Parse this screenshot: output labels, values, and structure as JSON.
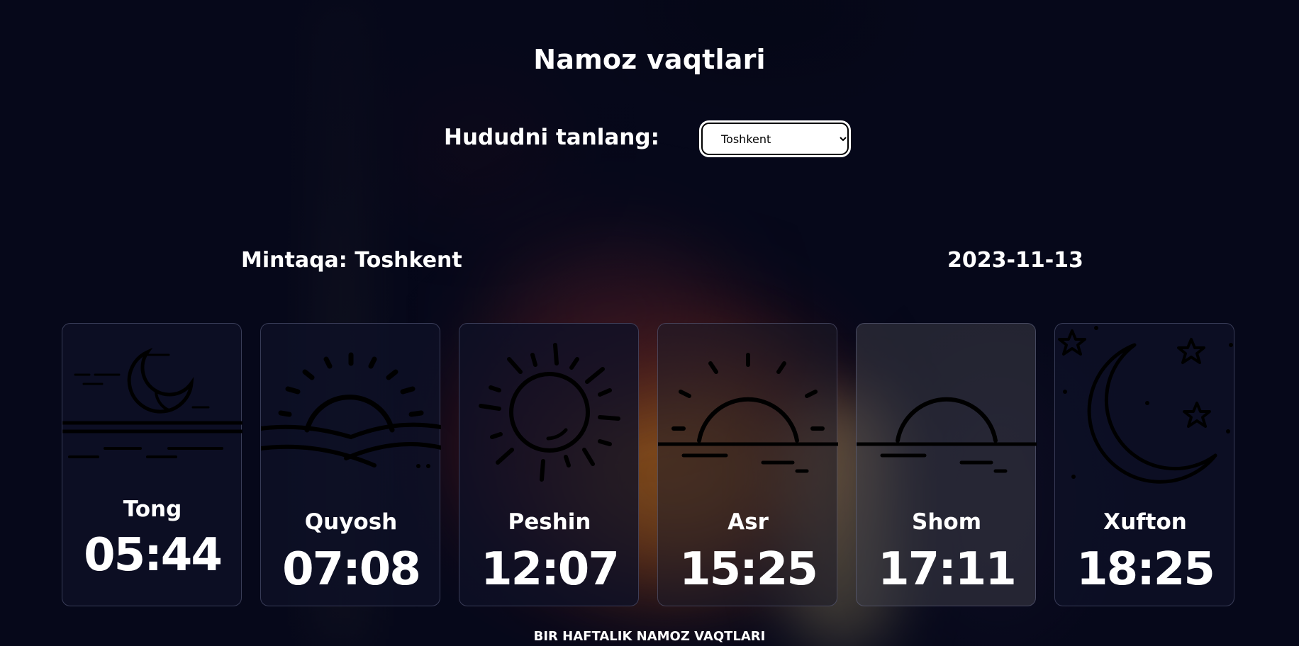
{
  "header": {
    "title": "Namoz vaqtlari"
  },
  "region": {
    "label": "Hududni tanlang:",
    "selected": "Toshkent",
    "options": [
      "Toshkent"
    ]
  },
  "info": {
    "mintaqa": "Mintaqa: Toshkent",
    "date": "2023-11-13"
  },
  "prayers": [
    {
      "name": "Tong",
      "time": "05:44",
      "icon": "moon-over-water-icon"
    },
    {
      "name": "Quyosh",
      "time": "07:08",
      "icon": "sunrise-over-hills-icon"
    },
    {
      "name": "Peshin",
      "time": "12:07",
      "icon": "sun-icon"
    },
    {
      "name": "Asr",
      "time": "15:25",
      "icon": "sun-on-horizon-icon"
    },
    {
      "name": "Shom",
      "time": "17:11",
      "icon": "sunset-icon"
    },
    {
      "name": "Xufton",
      "time": "18:25",
      "icon": "crescent-moon-stars-icon"
    }
  ],
  "footer": {
    "weekly_label": "BIR HAFTALIK NAMOZ VAQTLARI"
  },
  "colors": {
    "background": "#06081a",
    "card": "#0e1126",
    "text": "#ffffff",
    "icon_stroke": "#000000"
  }
}
